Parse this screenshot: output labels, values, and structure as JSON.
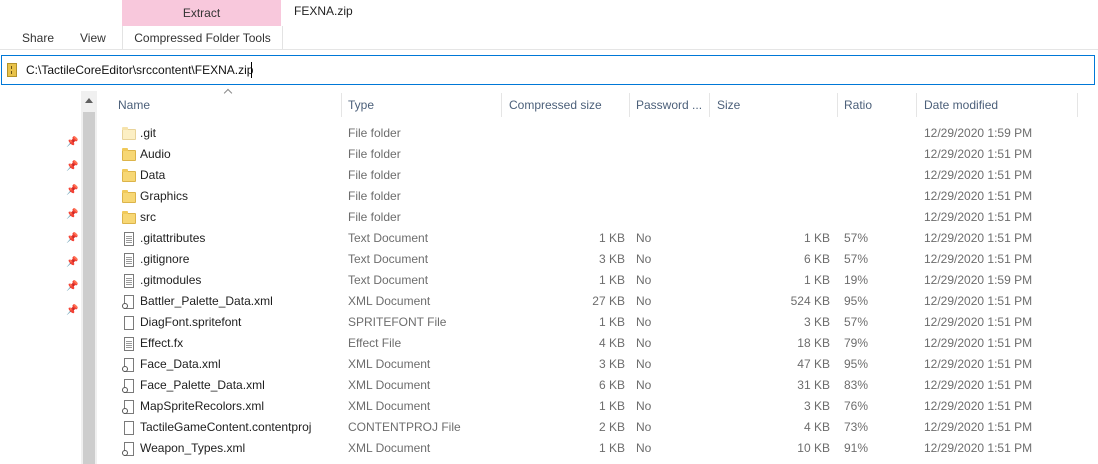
{
  "ribbon": {
    "context_header": "Extract",
    "context_tab": "Compressed Folder Tools",
    "tabs": [
      "Share",
      "View"
    ],
    "window_title": "FEXNA.zip"
  },
  "address": {
    "path": "C:\\TactileCoreEditor\\srccontent\\FEXNA.zip",
    "icon": "zip-folder-icon"
  },
  "nav": {
    "pin_icon": "pin-icon",
    "pins": [
      "📌",
      "📌",
      "📌",
      "📌",
      "📌",
      "📌",
      "📌",
      "📌"
    ]
  },
  "columns": {
    "name": "Name",
    "type": "Type",
    "compressed_size": "Compressed size",
    "password": "Password ...",
    "size": "Size",
    "ratio": "Ratio",
    "date_modified": "Date modified"
  },
  "files": [
    {
      "name": ".git",
      "icon": "folder-icon-light",
      "type": "File folder",
      "compressed": "",
      "password": "",
      "size": "",
      "ratio": "",
      "date": "12/29/2020 1:59 PM"
    },
    {
      "name": "Audio",
      "icon": "folder-icon",
      "type": "File folder",
      "compressed": "",
      "password": "",
      "size": "",
      "ratio": "",
      "date": "12/29/2020 1:51 PM"
    },
    {
      "name": "Data",
      "icon": "folder-icon",
      "type": "File folder",
      "compressed": "",
      "password": "",
      "size": "",
      "ratio": "",
      "date": "12/29/2020 1:51 PM"
    },
    {
      "name": "Graphics",
      "icon": "folder-icon",
      "type": "File folder",
      "compressed": "",
      "password": "",
      "size": "",
      "ratio": "",
      "date": "12/29/2020 1:51 PM"
    },
    {
      "name": "src",
      "icon": "folder-icon",
      "type": "File folder",
      "compressed": "",
      "password": "",
      "size": "",
      "ratio": "",
      "date": "12/29/2020 1:51 PM"
    },
    {
      "name": ".gitattributes",
      "icon": "text-document-icon",
      "type": "Text Document",
      "compressed": "1 KB",
      "password": "No",
      "size": "1 KB",
      "ratio": "57%",
      "date": "12/29/2020 1:51 PM"
    },
    {
      "name": ".gitignore",
      "icon": "text-document-icon",
      "type": "Text Document",
      "compressed": "3 KB",
      "password": "No",
      "size": "6 KB",
      "ratio": "57%",
      "date": "12/29/2020 1:51 PM"
    },
    {
      "name": ".gitmodules",
      "icon": "text-document-icon",
      "type": "Text Document",
      "compressed": "1 KB",
      "password": "No",
      "size": "1 KB",
      "ratio": "19%",
      "date": "12/29/2020 1:59 PM"
    },
    {
      "name": "Battler_Palette_Data.xml",
      "icon": "xml-document-icon",
      "type": "XML Document",
      "compressed": "27 KB",
      "password": "No",
      "size": "524 KB",
      "ratio": "95%",
      "date": "12/29/2020 1:51 PM"
    },
    {
      "name": "DiagFont.spritefont",
      "icon": "generic-file-icon",
      "type": "SPRITEFONT File",
      "compressed": "1 KB",
      "password": "No",
      "size": "3 KB",
      "ratio": "57%",
      "date": "12/29/2020 1:51 PM"
    },
    {
      "name": "Effect.fx",
      "icon": "text-document-icon",
      "type": "Effect File",
      "compressed": "4 KB",
      "password": "No",
      "size": "18 KB",
      "ratio": "79%",
      "date": "12/29/2020 1:51 PM"
    },
    {
      "name": "Face_Data.xml",
      "icon": "xml-document-icon",
      "type": "XML Document",
      "compressed": "3 KB",
      "password": "No",
      "size": "47 KB",
      "ratio": "95%",
      "date": "12/29/2020 1:51 PM"
    },
    {
      "name": "Face_Palette_Data.xml",
      "icon": "xml-document-icon",
      "type": "XML Document",
      "compressed": "6 KB",
      "password": "No",
      "size": "31 KB",
      "ratio": "83%",
      "date": "12/29/2020 1:51 PM"
    },
    {
      "name": "MapSpriteRecolors.xml",
      "icon": "xml-document-icon",
      "type": "XML Document",
      "compressed": "1 KB",
      "password": "No",
      "size": "3 KB",
      "ratio": "76%",
      "date": "12/29/2020 1:51 PM"
    },
    {
      "name": "TactileGameContent.contentproj",
      "icon": "generic-file-icon",
      "type": "CONTENTPROJ File",
      "compressed": "2 KB",
      "password": "No",
      "size": "4 KB",
      "ratio": "73%",
      "date": "12/29/2020 1:51 PM"
    },
    {
      "name": "Weapon_Types.xml",
      "icon": "xml-document-icon",
      "type": "XML Document",
      "compressed": "1 KB",
      "password": "No",
      "size": "10 KB",
      "ratio": "91%",
      "date": "12/29/2020 1:51 PM"
    }
  ]
}
